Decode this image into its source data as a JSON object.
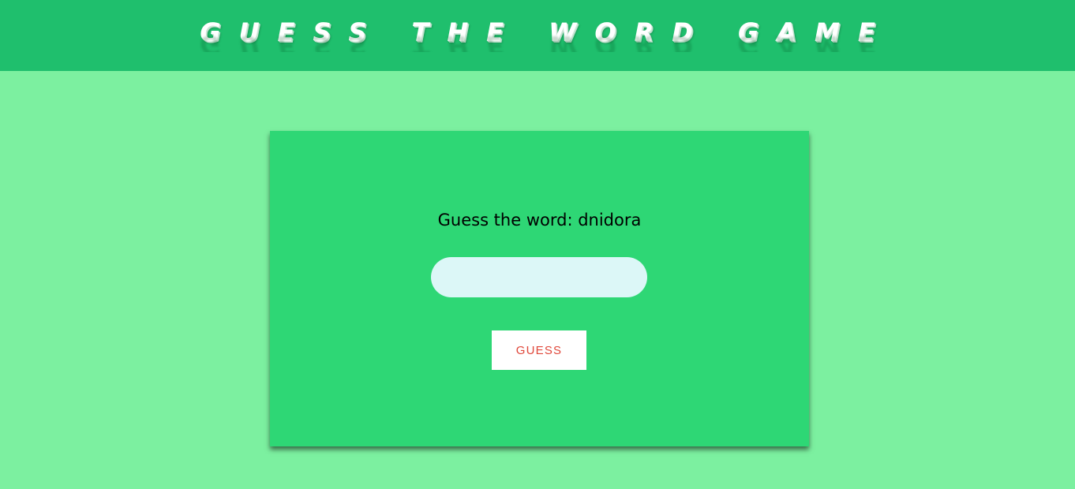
{
  "header": {
    "title": "GUESS THE WORD GAME"
  },
  "game": {
    "prompt": "Guess the word: dnidora",
    "input_value": "",
    "input_placeholder": "",
    "guess_button_label": "GUESS"
  },
  "colors": {
    "page_background": "#7cf0a0",
    "header_background": "#1fbf6d",
    "card_background": "#2ed775",
    "input_background": "#dcf7f7",
    "button_text": "#e0473a"
  }
}
